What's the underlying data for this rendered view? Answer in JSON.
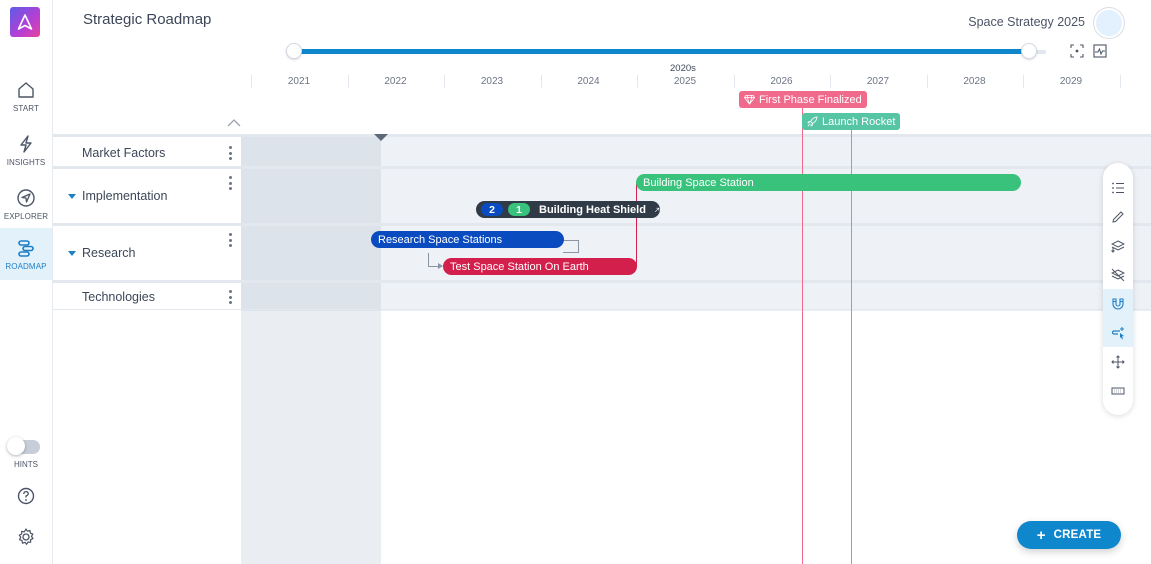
{
  "header": {
    "title": "Strategic Roadmap",
    "project": "Space Strategy 2025"
  },
  "nav": {
    "items": [
      {
        "label": "START",
        "icon": "home-icon"
      },
      {
        "label": "INSIGHTS",
        "icon": "lightning-icon"
      },
      {
        "label": "EXPLORER",
        "icon": "compass-icon"
      },
      {
        "label": "ROADMAP",
        "icon": "roadmap-icon",
        "active": true
      }
    ],
    "hints_label": "HINTS",
    "hints_enabled": false
  },
  "timeline": {
    "decade_label": "2020s",
    "years": [
      "2021",
      "2022",
      "2023",
      "2024",
      "2025",
      "2026",
      "2027",
      "2028",
      "2029"
    ],
    "range_slider": {
      "start": "2021",
      "end": "2029"
    }
  },
  "milestones": [
    {
      "label": "First Phase Finalized",
      "icon": "diamond-icon",
      "color": "#f06a8c"
    },
    {
      "label": "Launch Rocket",
      "icon": "rocket-icon",
      "color": "#56c5a3"
    }
  ],
  "lanes": [
    {
      "name": "Market Factors",
      "expandable": false
    },
    {
      "name": "Implementation",
      "expandable": true
    },
    {
      "name": "Research",
      "expandable": true
    },
    {
      "name": "Technologies",
      "expandable": false
    }
  ],
  "bars": {
    "building_space_station": {
      "label": "Building Space Station",
      "color": "#38c27b"
    },
    "building_heat_shield": {
      "label": "Building Heat Shield",
      "badge_blue": "2",
      "badge_green": "1",
      "color": "#313b48"
    },
    "research_space_stations": {
      "label": "Research Space Stations",
      "color": "#0a4cbf"
    },
    "test_space_station": {
      "label": "Test Space Station On Earth",
      "color": "#d21f4b"
    }
  },
  "toolbar": {
    "tools": [
      {
        "name": "list-icon"
      },
      {
        "name": "pencil-icon"
      },
      {
        "name": "layers-down-icon"
      },
      {
        "name": "layers-off-icon"
      },
      {
        "name": "magnet-icon",
        "active": true
      },
      {
        "name": "link-cursor-icon",
        "active": true
      },
      {
        "name": "move-icon"
      },
      {
        "name": "keyboard-icon"
      }
    ]
  },
  "create_label": "CREATE"
}
